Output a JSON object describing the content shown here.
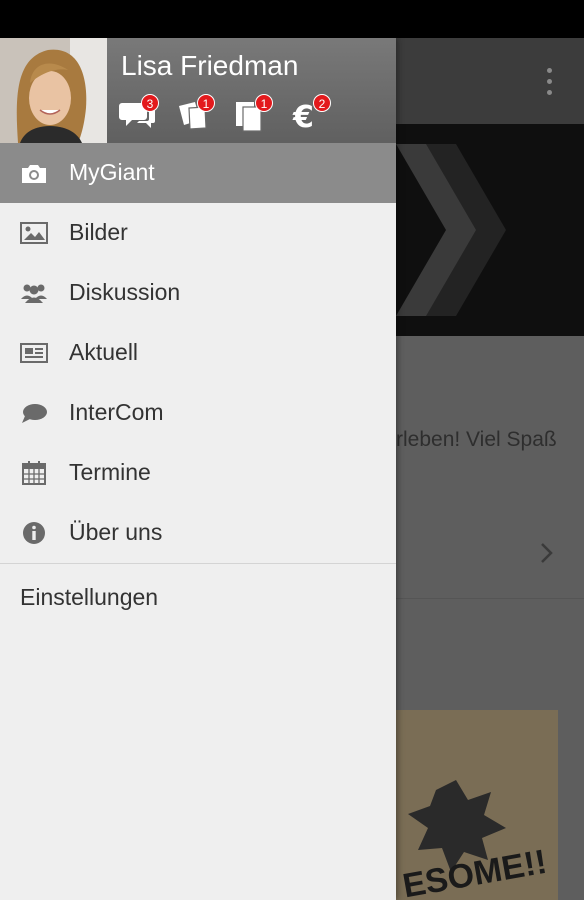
{
  "user": {
    "name": "Lisa Friedman"
  },
  "header_icons": [
    {
      "icon": "chat-bubbles-icon",
      "badge": "3"
    },
    {
      "icon": "tickets-icon",
      "badge": "1"
    },
    {
      "icon": "copy-pages-icon",
      "badge": "1"
    },
    {
      "icon": "euro-icon",
      "badge": "2"
    }
  ],
  "menu": [
    {
      "label": "MyGiant",
      "icon": "camera-icon",
      "active": true
    },
    {
      "label": "Bilder",
      "icon": "image-icon"
    },
    {
      "label": "Diskussion",
      "icon": "group-icon"
    },
    {
      "label": "Aktuell",
      "icon": "newspaper-icon"
    },
    {
      "label": "InterCom",
      "icon": "speech-bubble-icon"
    },
    {
      "label": "Termine",
      "icon": "calendar-icon"
    },
    {
      "label": "Über uns",
      "icon": "info-icon"
    }
  ],
  "settings_label": "Einstellungen",
  "background": {
    "text_snippet": "rleben! Viel Spaß",
    "image_text": "ESOME!!"
  },
  "colors": {
    "badge": "#e3191c",
    "active_item": "#8b8b8b",
    "drawer_bg": "#efefef"
  }
}
